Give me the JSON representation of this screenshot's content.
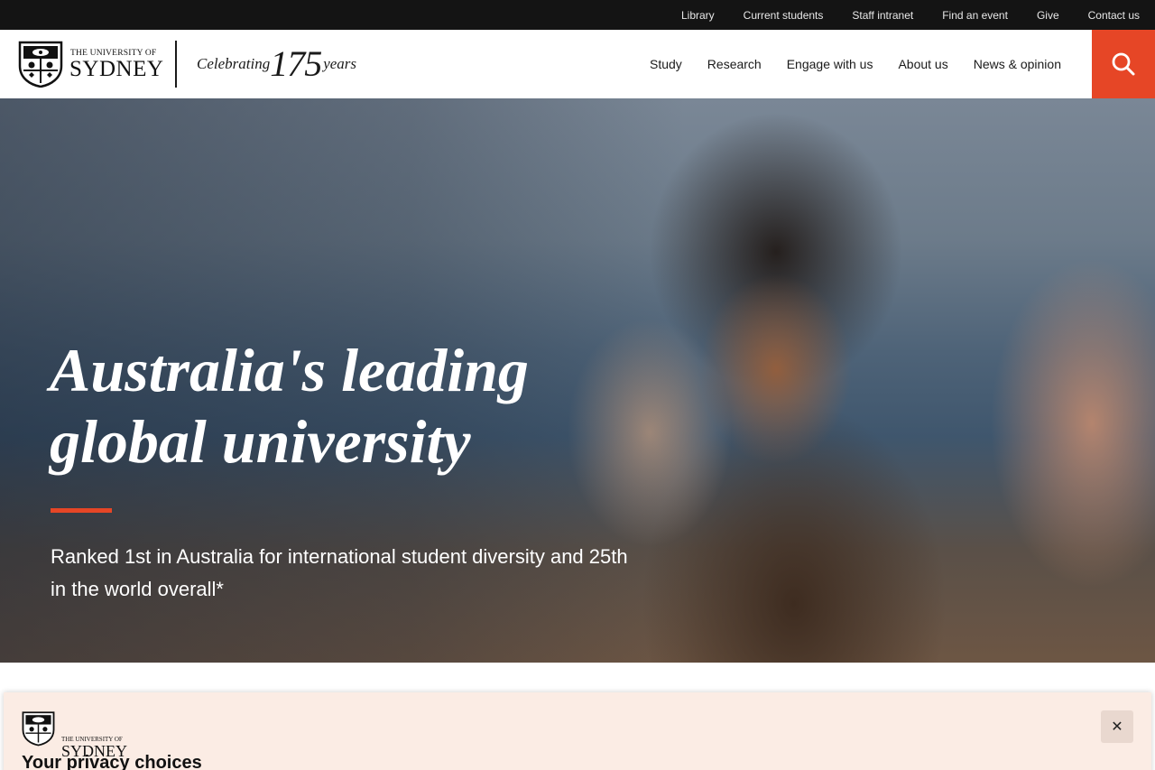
{
  "utility_nav": [
    "Library",
    "Current students",
    "Staff intranet",
    "Find an event",
    "Give",
    "Contact us"
  ],
  "logo": {
    "small_text": "THE UNIVERSITY OF",
    "big_text": "SYDNEY"
  },
  "anniversary": {
    "word": "Celebrating",
    "number": "175",
    "unit": "years"
  },
  "main_nav": [
    "Study",
    "Research",
    "Engage with us",
    "About us",
    "News & opinion"
  ],
  "search_icon": "search-icon",
  "hero": {
    "title_line1": "Australia's leading",
    "title_line2": "global university",
    "subtitle": "Ranked 1st in Australia for international student diversity and 25th in the world overall*"
  },
  "privacy": {
    "logo_small": "THE UNIVERSITY OF",
    "logo_big": "SYDNEY",
    "title": "Your privacy choices",
    "close_label": "✕"
  },
  "colors": {
    "accent": "#e64626",
    "utility_bar": "#141414",
    "privacy_bg": "#fbece4"
  }
}
